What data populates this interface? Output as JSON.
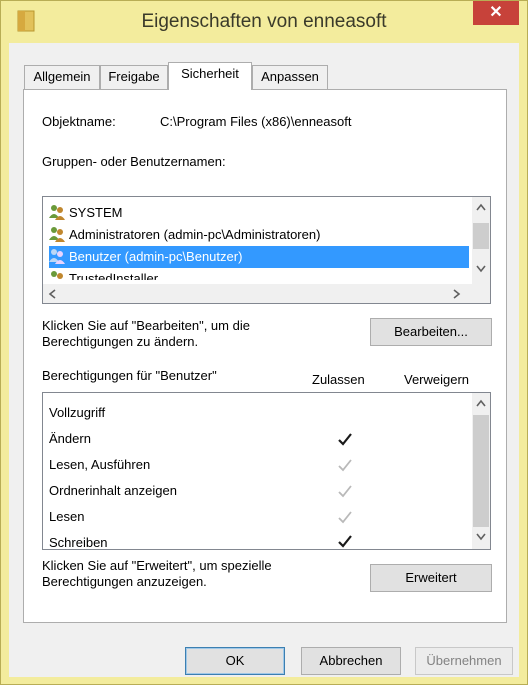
{
  "window": {
    "title": "Eigenschaften von enneasoft",
    "close_glyph": "✕"
  },
  "tabs": [
    {
      "label": "Allgemein",
      "active": false
    },
    {
      "label": "Freigabe",
      "active": false
    },
    {
      "label": "Sicherheit",
      "active": true
    },
    {
      "label": "Anpassen",
      "active": false
    }
  ],
  "security": {
    "object_label": "Objektname:",
    "object_value": "C:\\Program Files (x86)\\enneasoft",
    "groups_label": "Gruppen- oder Benutzernamen:",
    "groups": [
      {
        "name": "SYSTEM",
        "selected": false
      },
      {
        "name": "Administratoren (admin-pc\\Administratoren)",
        "selected": false
      },
      {
        "name": "Benutzer (admin-pc\\Benutzer)",
        "selected": true
      },
      {
        "name": "TrustedInstaller",
        "selected": false
      }
    ],
    "edit_hint": "Klicken Sie auf \"Bearbeiten\", um die Berechtigungen zu ändern.",
    "edit_button": "Bearbeiten...",
    "permissions_label": "Berechtigungen für \"Benutzer\"",
    "allow_header": "Zulassen",
    "deny_header": "Verweigern",
    "permissions": [
      {
        "name": "Vollzugriff",
        "allow": "none"
      },
      {
        "name": "Ändern",
        "allow": "checked"
      },
      {
        "name": "Lesen, Ausführen",
        "allow": "inherited"
      },
      {
        "name": "Ordnerinhalt anzeigen",
        "allow": "inherited"
      },
      {
        "name": "Lesen",
        "allow": "inherited"
      },
      {
        "name": "Schreiben",
        "allow": "checked"
      }
    ],
    "advanced_hint": "Klicken Sie auf \"Erweitert\", um spezielle Berechtigungen anzuzeigen.",
    "advanced_button": "Erweitert"
  },
  "buttons": {
    "ok": "OK",
    "cancel": "Abbrechen",
    "apply": "Übernehmen"
  },
  "colors": {
    "frame": "#f3ec9d",
    "close": "#c7423a",
    "selection": "#3399ff",
    "annotation_arrow": "#8b1a1a"
  }
}
